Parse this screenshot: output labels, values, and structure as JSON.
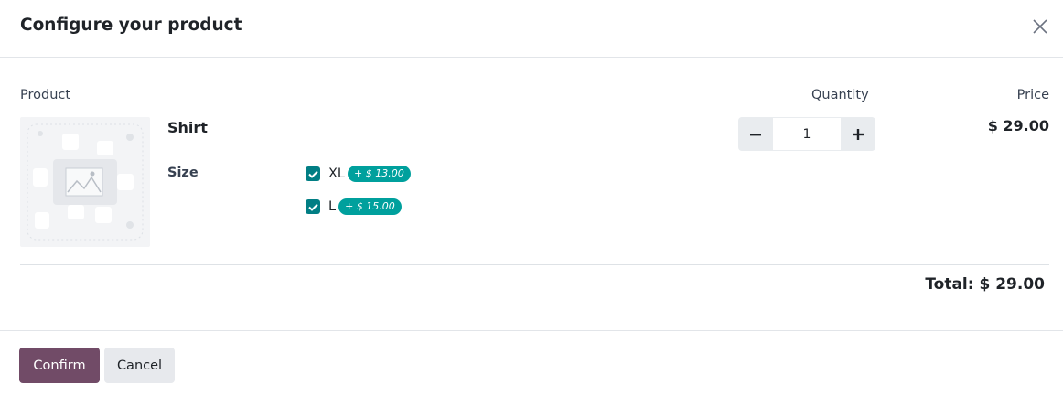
{
  "dialog": {
    "title": "Configure your product"
  },
  "columns": {
    "product": "Product",
    "quantity": "Quantity",
    "price": "Price"
  },
  "product": {
    "name": "Shirt",
    "image_icon": "placeholder-image-icon",
    "attribute": {
      "label": "Size",
      "options": [
        {
          "label": "XL",
          "extra": "+ $ 13.00",
          "checked": true
        },
        {
          "label": "L",
          "extra": "+ $ 15.00",
          "checked": true
        }
      ]
    },
    "quantity": "1",
    "price": "$ 29.00"
  },
  "total": "Total: $ 29.00",
  "footer": {
    "confirm_label": "Confirm",
    "cancel_label": "Cancel"
  },
  "colors": {
    "primary": "#714b67",
    "checkbox": "#017e84",
    "badge": "#00a09d"
  }
}
